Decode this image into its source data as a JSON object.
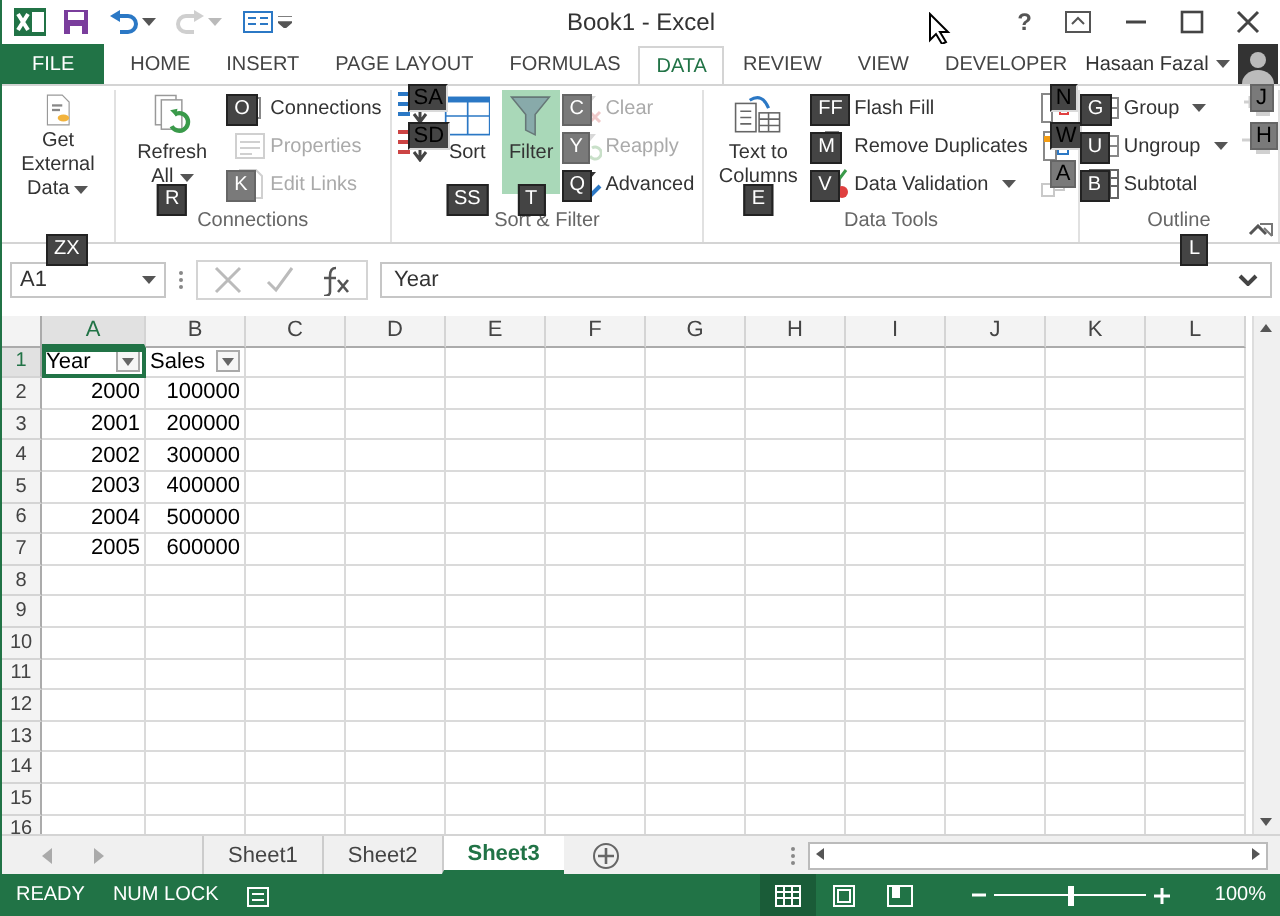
{
  "title_bar": {
    "title": "Book1 - Excel",
    "help": "?",
    "quick_access": [
      {
        "kind": "save",
        "disabled": false
      },
      {
        "kind": "undo",
        "disabled": false
      },
      {
        "kind": "redo",
        "disabled": true
      },
      {
        "kind": "customize",
        "disabled": false
      }
    ]
  },
  "tabs": [
    {
      "label": "FILE",
      "kind": "file",
      "selected": false
    },
    {
      "label": "HOME",
      "kind": "tab",
      "selected": false
    },
    {
      "label": "INSERT",
      "kind": "tab",
      "selected": false
    },
    {
      "label": "PAGE LAYOUT",
      "kind": "tab",
      "selected": false
    },
    {
      "label": "FORMULAS",
      "kind": "tab",
      "selected": false
    },
    {
      "label": "DATA",
      "kind": "tab",
      "selected": true
    },
    {
      "label": "REVIEW",
      "kind": "tab",
      "selected": false
    },
    {
      "label": "VIEW",
      "kind": "tab",
      "selected": false
    },
    {
      "label": "DEVELOPER",
      "kind": "tab",
      "selected": false
    }
  ],
  "user": {
    "name": "Hasaan Fazal"
  },
  "ribbon": {
    "groups": [
      {
        "columns": [
          [
            {
              "kind": "large",
              "label": "Get External Data",
              "dropdown": true,
              "disabled": false
            }
          ]
        ]
      },
      {
        "label": "Connections",
        "columns": [
          [
            {
              "kind": "large",
              "label": "Refresh All",
              "dropdown": true,
              "disabled": false,
              "keytip": "R"
            }
          ],
          [
            {
              "kind": "small",
              "label": "Connections",
              "disabled": false,
              "keytip": "O"
            },
            {
              "kind": "small",
              "label": "Properties",
              "disabled": true
            },
            {
              "kind": "small",
              "label": "Edit Links",
              "disabled": true,
              "keytip": "K"
            }
          ]
        ]
      },
      {
        "label": "Sort & Filter",
        "columns": [
          [
            {
              "kind": "icon",
              "disabled": false,
              "keytip": "SA"
            },
            {
              "kind": "icon",
              "disabled": false,
              "keytip": "SD"
            }
          ],
          [
            {
              "kind": "large",
              "label": "Sort",
              "disabled": false,
              "keytip": "SS"
            }
          ],
          [
            {
              "kind": "large",
              "label": "Filter",
              "disabled": false,
              "selected": true,
              "keytip": "T"
            }
          ],
          [
            {
              "kind": "small",
              "label": "Clear",
              "disabled": true,
              "keytip": "C"
            },
            {
              "kind": "small",
              "label": "Reapply",
              "disabled": true,
              "keytip": "Y"
            },
            {
              "kind": "small",
              "label": "Advanced",
              "disabled": false,
              "keytip": "Q"
            }
          ]
        ]
      },
      {
        "label": "Data Tools",
        "columns": [
          [
            {
              "kind": "large",
              "label": "Text to Columns",
              "disabled": false,
              "keytip": "E"
            }
          ],
          [
            {
              "kind": "small",
              "label": "Flash Fill",
              "disabled": false,
              "keytip": "FF"
            },
            {
              "kind": "small",
              "label": "Remove Duplicates",
              "disabled": false,
              "keytip": "M"
            },
            {
              "kind": "small",
              "label": "Data Validation",
              "dropdown": true,
              "disabled": false,
              "keytip": "V"
            }
          ],
          [
            {
              "kind": "icon",
              "disabled": false,
              "keytip": "N"
            },
            {
              "kind": "icon",
              "disabled": false,
              "keytip": "W"
            },
            {
              "kind": "icon",
              "disabled": true,
              "keytip": "A"
            }
          ]
        ]
      },
      {
        "label": "Outline",
        "launcher": true,
        "columns": [
          [
            {
              "kind": "small",
              "label": "Group",
              "dropdown": true,
              "disabled": false,
              "keytip": "G"
            },
            {
              "kind": "small",
              "label": "Ungroup",
              "dropdown": true,
              "disabled": false,
              "keytip": "U"
            },
            {
              "kind": "small",
              "label": "Subtotal",
              "disabled": false,
              "keytip": "B"
            }
          ],
          [
            {
              "kind": "icon",
              "disabled": true,
              "keytip": "J"
            },
            {
              "kind": "icon",
              "disabled": true,
              "keytip": "H"
            }
          ]
        ]
      }
    ]
  },
  "formula_bar": {
    "name_box": "A1",
    "name_box_keytip": "ZX",
    "formula": "Year",
    "expand_keytip": "L"
  },
  "sheet": {
    "columns": [
      {
        "label": "A",
        "selected": true
      },
      {
        "label": "B",
        "selected": false
      },
      {
        "label": "C",
        "selected": false
      },
      {
        "label": "D",
        "selected": false
      },
      {
        "label": "E",
        "selected": false
      },
      {
        "label": "F",
        "selected": false
      },
      {
        "label": "G",
        "selected": false
      },
      {
        "label": "H",
        "selected": false
      },
      {
        "label": "I",
        "selected": false
      },
      {
        "label": "J",
        "selected": false
      },
      {
        "label": "K",
        "selected": false
      },
      {
        "label": "L",
        "selected": false
      }
    ],
    "rows": [
      {
        "number": "1",
        "selected": true,
        "cells": [
          {
            "text": "Year",
            "kind": "text",
            "filter_button": true,
            "selected": true
          },
          {
            "text": "Sales",
            "kind": "text",
            "filter_button": true,
            "selected": false
          }
        ]
      },
      {
        "number": "2",
        "selected": false,
        "cells": [
          {
            "text": "2000",
            "kind": "number",
            "selected": false
          },
          {
            "text": "100000",
            "kind": "number",
            "selected": false
          }
        ]
      },
      {
        "number": "3",
        "selected": false,
        "cells": [
          {
            "text": "2001",
            "kind": "number",
            "selected": false
          },
          {
            "text": "200000",
            "kind": "number",
            "selected": false
          }
        ]
      },
      {
        "number": "4",
        "selected": false,
        "cells": [
          {
            "text": "2002",
            "kind": "number",
            "selected": false
          },
          {
            "text": "300000",
            "kind": "number",
            "selected": false
          }
        ]
      },
      {
        "number": "5",
        "selected": false,
        "cells": [
          {
            "text": "2003",
            "kind": "number",
            "selected": false
          },
          {
            "text": "400000",
            "kind": "number",
            "selected": false
          }
        ]
      },
      {
        "number": "6",
        "selected": false,
        "cells": [
          {
            "text": "2004",
            "kind": "number",
            "selected": false
          },
          {
            "text": "500000",
            "kind": "number",
            "selected": false
          }
        ]
      },
      {
        "number": "7",
        "selected": false,
        "cells": [
          {
            "text": "2005",
            "kind": "number",
            "selected": false
          },
          {
            "text": "600000",
            "kind": "number",
            "selected": false
          }
        ]
      },
      {
        "number": "8",
        "selected": false
      },
      {
        "number": "9",
        "selected": false
      },
      {
        "number": "10",
        "selected": false
      },
      {
        "number": "11",
        "selected": false
      },
      {
        "number": "12",
        "selected": false
      },
      {
        "number": "13",
        "selected": false
      },
      {
        "number": "14",
        "selected": false
      },
      {
        "number": "15",
        "selected": false
      },
      {
        "number": "16",
        "selected": false
      }
    ]
  },
  "sheet_tabs": [
    {
      "label": "Sheet1",
      "selected": false
    },
    {
      "label": "Sheet2",
      "selected": false
    },
    {
      "label": "Sheet3",
      "selected": true
    }
  ],
  "status_bar": {
    "mode": "READY",
    "num_lock": "NUM LOCK",
    "views": [
      {
        "kind": "normal",
        "selected": true
      },
      {
        "kind": "page_layout",
        "selected": false
      },
      {
        "kind": "page_break",
        "selected": false
      }
    ],
    "zoom": {
      "level": 0.5,
      "reading": "100%"
    }
  }
}
